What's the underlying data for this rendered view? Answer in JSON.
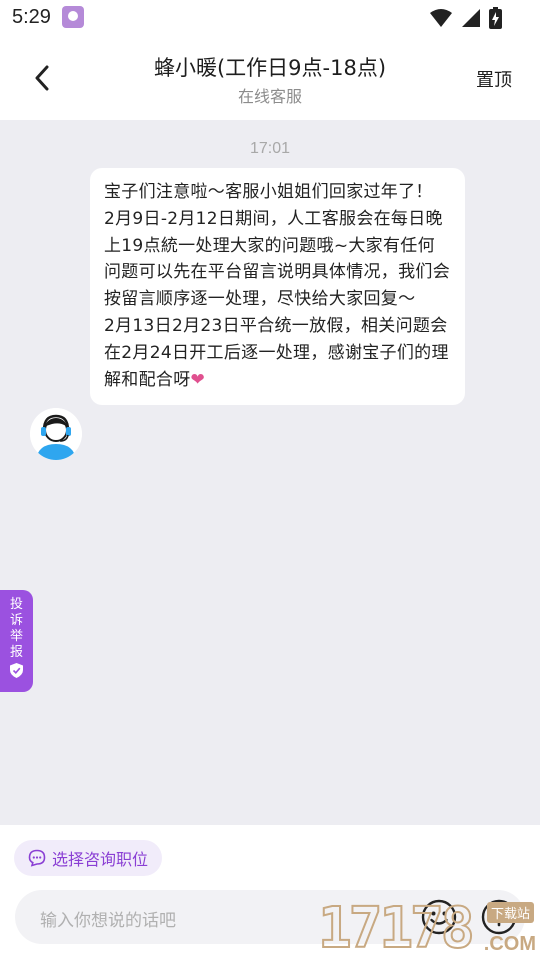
{
  "status_bar": {
    "time": "5:29"
  },
  "header": {
    "title": "蜂小暖(工作日9点-18点)",
    "subtitle": "在线客服",
    "pin_label": "置顶"
  },
  "chat": {
    "timestamp": "17:01",
    "messages": [
      {
        "sender": "agent",
        "lines": [
          "宝子们注意啦～客服小姐姐们回家过年了！",
          "2月9日-2月12日期间，人工客服会在每日晚上19点統一处理大家的问题哦~大家有任何问题可以先在平台留言说明具体情况，我们会按留言顺序逐一处理，尽快给大家回复～",
          "2月13日2月23日平合统一放假，相关问题会在2月24日开工后逐一处理，感谢宝子们的理解和配合呀"
        ],
        "emoji": "❤"
      }
    ]
  },
  "complaint_tab": {
    "label": "投诉举报"
  },
  "bottom": {
    "job_chip_label": "选择咨询职位",
    "input_placeholder": "输入你想说的话吧"
  },
  "watermark": {
    "digits": "17178",
    "badge": "下载站",
    "suffix": ".COM"
  },
  "colors": {
    "accent": "#9b51e0",
    "chat_bg": "#ededf2",
    "heart": "#e0508f"
  },
  "icons": [
    "back-arrow-icon",
    "wifi-icon",
    "signal-icon",
    "battery-icon",
    "agent-avatar-icon",
    "shield-check-icon",
    "chat-bubble-icon",
    "emoji-icon",
    "plus-circle-icon"
  ]
}
